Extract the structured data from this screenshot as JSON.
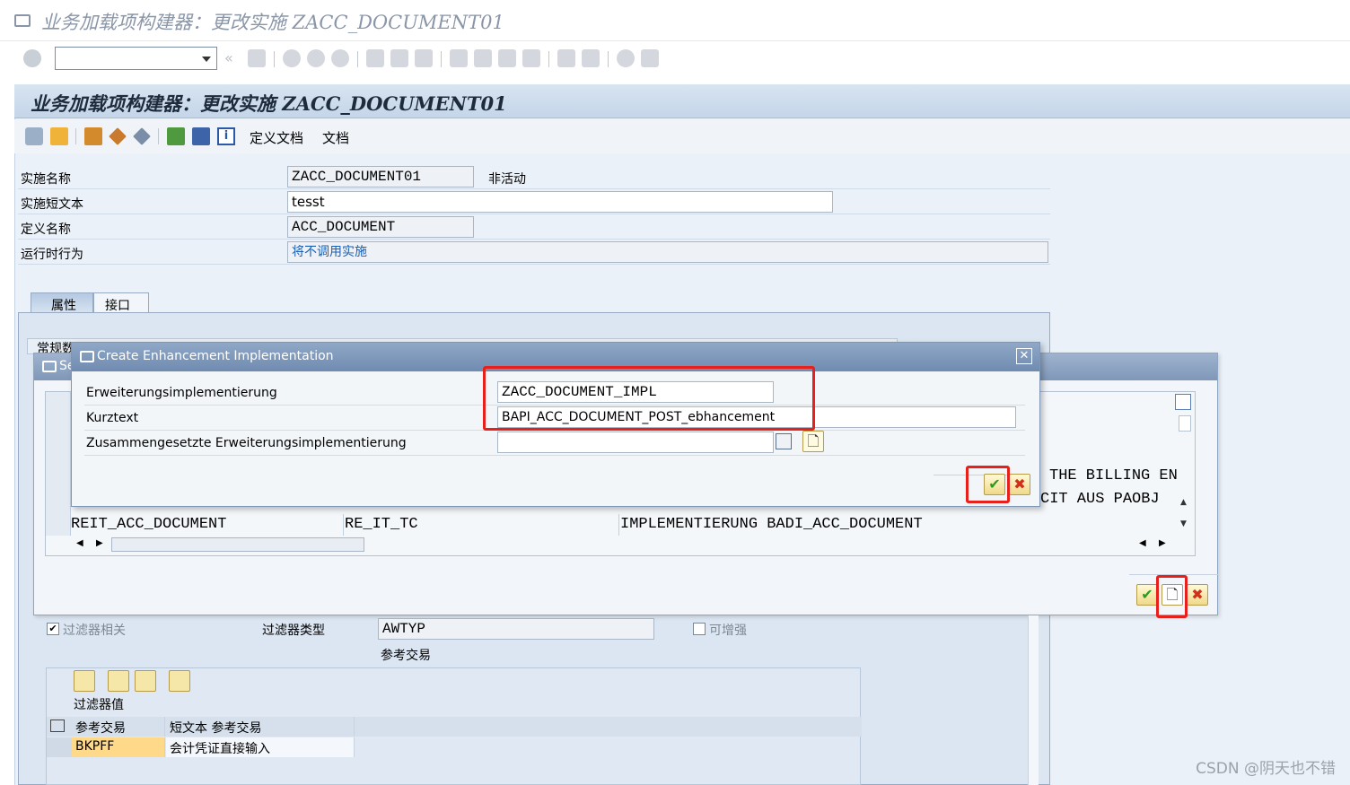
{
  "window": {
    "title": "业务加载项构建器：更改实施 ZACC_DOCUMENT01"
  },
  "screen": {
    "header_title": "业务加载项构建器：更改实施 ZACC_DOCUMENT01",
    "toolbar_text_buttons": [
      "定义文档",
      "文档"
    ]
  },
  "form": {
    "impl_name_label": "实施名称",
    "impl_name_value": "ZACC_DOCUMENT01",
    "impl_status": "非活动",
    "short_text_label": "实施短文本",
    "short_text_value": "tesst",
    "def_name_label": "定义名称",
    "def_name_value": "ACC_DOCUMENT",
    "runtime_label": "运行时行为",
    "runtime_value": "将不调用实施"
  },
  "tabs": [
    "属性",
    "接口"
  ],
  "tab_panel_partial_label": "常规数",
  "back_dialog": {
    "title_partial": "Se",
    "rows": [
      {
        "col1": "",
        "col2": "",
        "col3": "THE BILLING EN"
      },
      {
        "col1": "",
        "col2": "",
        "col3": "CIT AUS PAOBJ"
      },
      {
        "col1": "REIT_ACC_DOCUMENT",
        "col2": "RE_IT_TC",
        "col3": "IMPLEMENTIERUNG BADI_ACC_DOCUMENT"
      }
    ]
  },
  "front_dialog": {
    "title": "Create Enhancement Implementation",
    "enh_impl_label": "Erweiterungsimplementierung",
    "enh_impl_value": "ZACC_DOCUMENT_IMPL",
    "short_text_label": "Kurztext",
    "short_text_value": "BAPI_ACC_DOCUMENT_POST_ebhancement",
    "composite_label": "Zusammengesetzte Erweiterungsimplementierung",
    "composite_value": ""
  },
  "filter": {
    "filter_relevant_label": "过滤器相关",
    "filter_type_label": "过滤器类型",
    "filter_type_value": "AWTYP",
    "filter_type_desc": "参考交易",
    "extensible_label": "可增强",
    "filter_values_title": "过滤器值",
    "columns": [
      "参考交易",
      "短文本 参考交易"
    ],
    "rows": [
      {
        "code": "BKPFF",
        "text": "会计凭证直接输入"
      }
    ]
  },
  "watermark": "CSDN @阴天也不错",
  "colors": {
    "highlight_red": "#e8201c",
    "accept_green": "#2e9b1e",
    "cancel_red": "#d0301a",
    "link_blue": "#1a5fb4"
  }
}
